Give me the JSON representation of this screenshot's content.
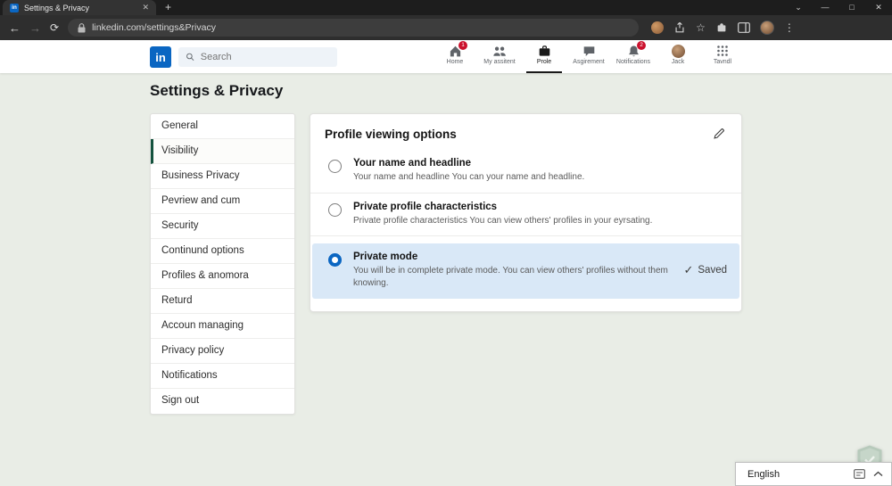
{
  "browser": {
    "tab_title": "Settings & Privacy",
    "url": "linkedin.com/settings&Privacy"
  },
  "header": {
    "logo_text": "in",
    "search_placeholder": "Search",
    "nav": [
      {
        "label": "Home",
        "badge": "1"
      },
      {
        "label": "My assitent",
        "badge": ""
      },
      {
        "label": "Prole",
        "badge": ""
      },
      {
        "label": "Asgirement",
        "badge": ""
      },
      {
        "label": "Notifications",
        "badge": "2"
      },
      {
        "label": "Jack",
        "badge": ""
      },
      {
        "label": "Tavndl",
        "badge": ""
      }
    ]
  },
  "page": {
    "title": "Settings & Privacy",
    "sidebar": {
      "items": [
        {
          "label": "General"
        },
        {
          "label": "Visibility"
        },
        {
          "label": "Business Privacy"
        },
        {
          "label": "Pevriew and cum"
        },
        {
          "label": "Security"
        },
        {
          "label": "Continund options"
        },
        {
          "label": "Profiles & anomora"
        },
        {
          "label": "Returd"
        },
        {
          "label": "Accoun managing"
        },
        {
          "label": "Privacy policy"
        },
        {
          "label": "Notifications"
        },
        {
          "label": "Sign out"
        }
      ]
    },
    "panel": {
      "title": "Profile viewing options",
      "options": [
        {
          "label": "Your name and headline",
          "desc": "Your name and headline You can your name and headline."
        },
        {
          "label": "Private profile characteristics",
          "desc": "Private profile characteristics You can view others' profiles in your eyrsating."
        },
        {
          "label": "Private mode",
          "desc": "You will be in complete private mode. You can view others' profiles without them knowing.",
          "status": "Saved"
        }
      ]
    }
  },
  "footer": {
    "language": "English"
  },
  "colors": {
    "accent_blue": "#0a66c2",
    "selected_row_bg": "#d9e8f7",
    "badge_red": "#cb112d",
    "active_side_marker": "#14523d"
  }
}
